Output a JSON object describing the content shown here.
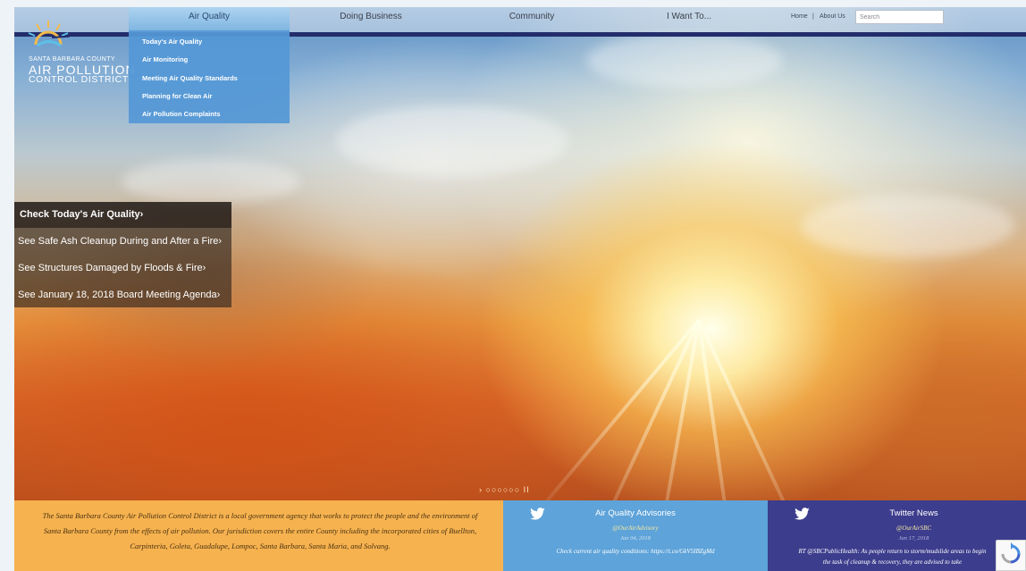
{
  "logo": {
    "line1": "Santa Barbara County",
    "line2": "Air Pollution",
    "line3": "Control District"
  },
  "nav": {
    "items": [
      {
        "label": "Air Quality"
      },
      {
        "label": "Doing Business"
      },
      {
        "label": "Community"
      },
      {
        "label": "I Want To..."
      }
    ],
    "dropdown": [
      "Today's Air Quality",
      "Air Monitoring",
      "Meeting Air Quality Standards",
      "Planning for Clean Air",
      "Air Pollution Complaints"
    ],
    "util_home": "Home",
    "util_sep": "|",
    "util_about": "About Us",
    "search_placeholder": "Search"
  },
  "hero": {
    "links": [
      "Check Today's Air Quality›",
      "See Safe Ash Cleanup During and After a Fire›",
      "See Structures Damaged by Floods & Fire›",
      "See January 18, 2018 Board Meeting Agenda›"
    ],
    "slider_prev": "›",
    "slider_dots": "○○○○○○",
    "slider_pause": "II"
  },
  "about": {
    "text": "The Santa Barbara County Air Pollution Control District is a local government agency that works to protect the people and the environment of Santa Barbara County from the effects of air pollution. Our jurisdiction covers the entire County including the incorporated cities of Buellton, Carpinteria, Goleta, Guadalupe, Lompoc, Santa Barbara, Santa Maria, and Solvang."
  },
  "advisory": {
    "title": "Air Quality Advisories",
    "handle": "@OurAirAdvisory",
    "date": "Jan 04, 2018",
    "body": "Check current air quality conditions: https://t.co/GkV5IBZgMd"
  },
  "twitter": {
    "title": "Twitter News",
    "handle": "@OurAirSBC",
    "date": "Jan 17, 2018",
    "body": "RT @SBCPublicHealth: As people return to storm/mudslide areas to begin the task of cleanup & recovery, they are advised to take"
  },
  "colors": {
    "nav_rule": "#232d6b",
    "dropdown": "#5498d6",
    "about_panel": "#f6b24f",
    "advisory_panel": "#5ea3d9",
    "twitter_panel": "#3c3d8d"
  },
  "icons": [
    "sun-logo-icon",
    "twitter-bird-icon",
    "recaptcha-icon"
  ]
}
